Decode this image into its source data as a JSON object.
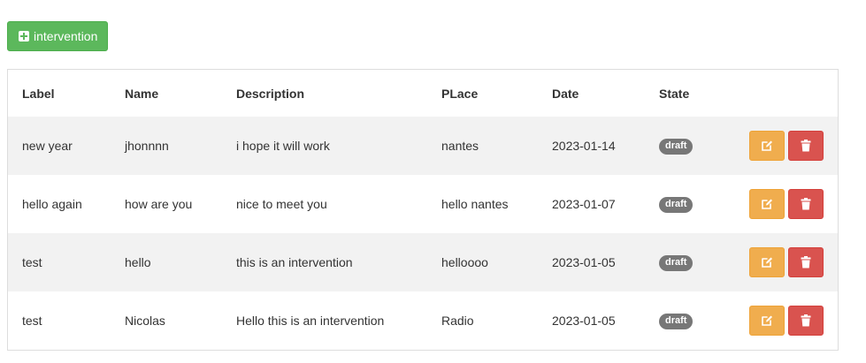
{
  "toolbar": {
    "add_label": "intervention",
    "add_icon": "plus-square-icon"
  },
  "table": {
    "headers": [
      "Label",
      "Name",
      "Description",
      "PLace",
      "Date",
      "State"
    ],
    "rows": [
      {
        "label": "new year",
        "name": "jhonnnn",
        "description": "i hope it will work",
        "place": "nantes",
        "date": "2023-01-14",
        "state": "draft"
      },
      {
        "label": "hello again",
        "name": "how are you",
        "description": "nice to meet you",
        "place": "hello nantes",
        "date": "2023-01-07",
        "state": "draft"
      },
      {
        "label": "test",
        "name": "hello",
        "description": "this is an intervention",
        "place": "helloooo",
        "date": "2023-01-05",
        "state": "draft"
      },
      {
        "label": "test",
        "name": "Nicolas",
        "description": "Hello this is an intervention",
        "place": "Radio",
        "date": "2023-01-05",
        "state": "draft"
      }
    ],
    "edit_icon": "edit-icon",
    "delete_icon": "trash-icon"
  },
  "colors": {
    "add_button": "#5cb85c",
    "edit_button": "#f0ad4e",
    "delete_button": "#d9534f",
    "badge": "#777777",
    "stripe": "#f2f2f2"
  }
}
